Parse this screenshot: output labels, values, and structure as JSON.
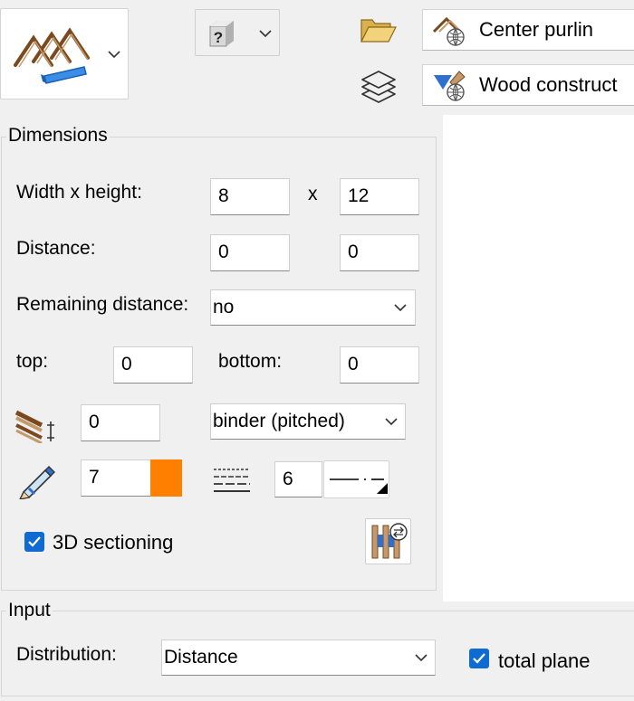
{
  "toolbar": {
    "type_button_icon": "rafters-icon",
    "help_icon": "question-mark-icon",
    "folder_icon": "folder-open-icon",
    "layers_icon": "layers-icon",
    "element_name": "Center purlin",
    "material_name": "Wood construct"
  },
  "dimensions": {
    "group_title": "Dimensions",
    "width_height_label": "Width x height:",
    "width_value": "8",
    "x_separator": "x",
    "height_value": "12",
    "distance_label": "Distance:",
    "distance_value_1": "0",
    "distance_value_2": "0",
    "remaining_distance_label": "Remaining distance:",
    "remaining_distance_value": "no",
    "top_label": "top:",
    "top_value": "0",
    "bottom_label": "bottom:",
    "bottom_value": "0",
    "offset_icon": "beam-offset-icon",
    "offset_value": "0",
    "binder_value": "binder (pitched)",
    "pen_icon": "pen-icon",
    "pen_value": "7",
    "pen_color": "#ff8000",
    "linestyle_icon": "line-style-icon",
    "linestyle_value": "6",
    "sectioning_label": "3D sectioning",
    "sectioning_checked": true,
    "distribute_icon": "purlin-settings-icon"
  },
  "input": {
    "group_title": "Input",
    "distribution_label": "Distribution:",
    "distribution_value": "Distance",
    "total_plane_label": "total plane",
    "total_plane_checked": true
  },
  "colors": {
    "accent": "#0f6bd1",
    "background": "#f0f0f0",
    "preview_bg": "#ffffff"
  }
}
